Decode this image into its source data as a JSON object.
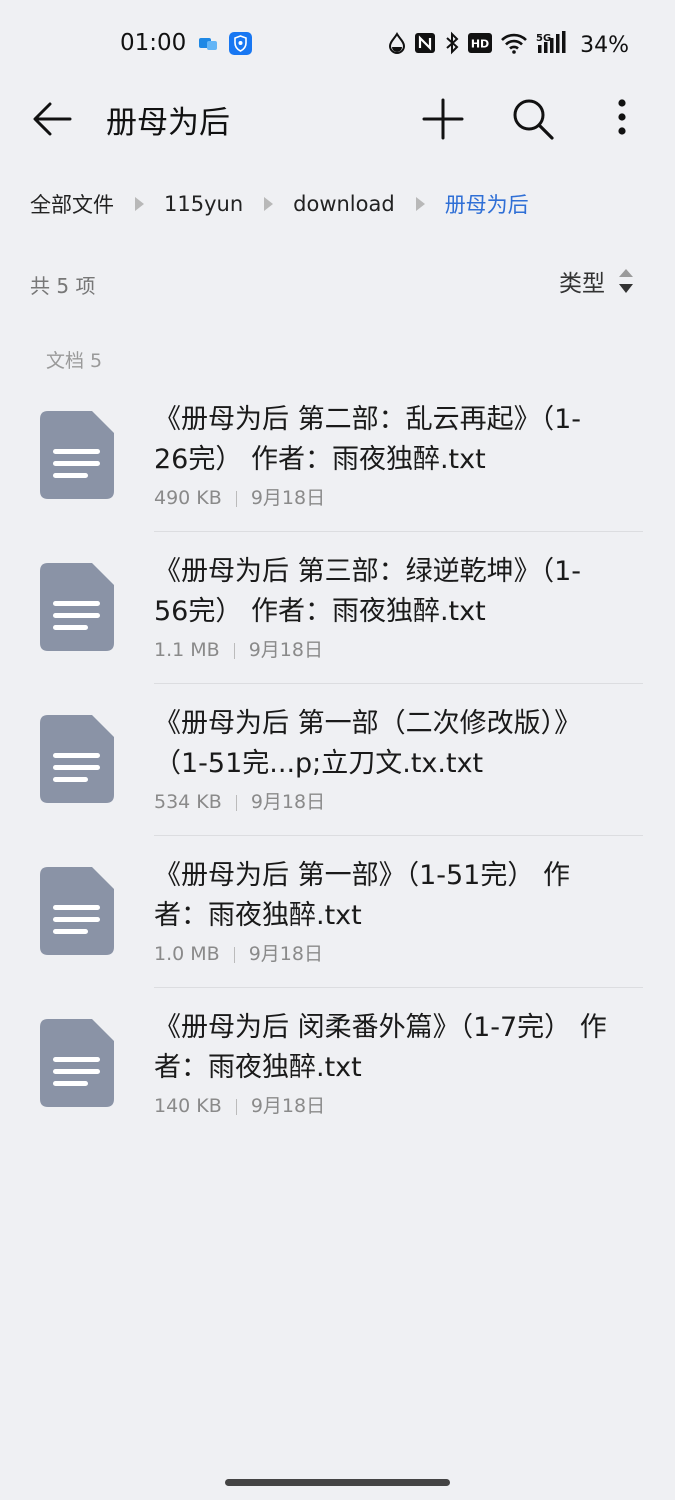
{
  "status_bar": {
    "time": "01:00",
    "battery": "34%",
    "icons": [
      "chat-notification-icon",
      "shield-notification-icon",
      "water-drop-icon",
      "nfc-icon",
      "bluetooth-icon",
      "hd-icon",
      "wifi-icon",
      "5g-signal-icon"
    ]
  },
  "appbar": {
    "title": "册母为后",
    "icons": [
      "back-arrow-icon",
      "plus-icon",
      "search-icon",
      "more-vertical-icon"
    ]
  },
  "breadcrumb": [
    "全部文件",
    "115yun",
    "download",
    "册母为后"
  ],
  "summary": {
    "count": "共 5 项",
    "sort_label": "类型"
  },
  "section_label": "文档 5",
  "files": [
    {
      "name": "《册母为后 第二部：乱云再起》（1-26完） 作者：雨夜独醉.txt",
      "size": "490 KB",
      "date": "9月18日"
    },
    {
      "name": "《册母为后 第三部：绿逆乾坤》（1-56完） 作者：雨夜独醉.txt",
      "size": "1.1 MB",
      "date": "9月18日"
    },
    {
      "name": "《册母为后 第一部（二次修改版）》（1-51完...p;立刀文.tx.txt",
      "size": "534 KB",
      "date": "9月18日"
    },
    {
      "name": "《册母为后 第一部》（1-51完） 作者：雨夜独醉.txt",
      "size": "1.0 MB",
      "date": "9月18日"
    },
    {
      "name": "《册母为后 闵柔番外篇》（1-7完） 作者：雨夜独醉.txt",
      "size": "140 KB",
      "date": "9月18日"
    }
  ],
  "colors": {
    "background": "#eff0f3",
    "accent": "#2f6fd6",
    "doc_icon": "#8a93a6"
  }
}
